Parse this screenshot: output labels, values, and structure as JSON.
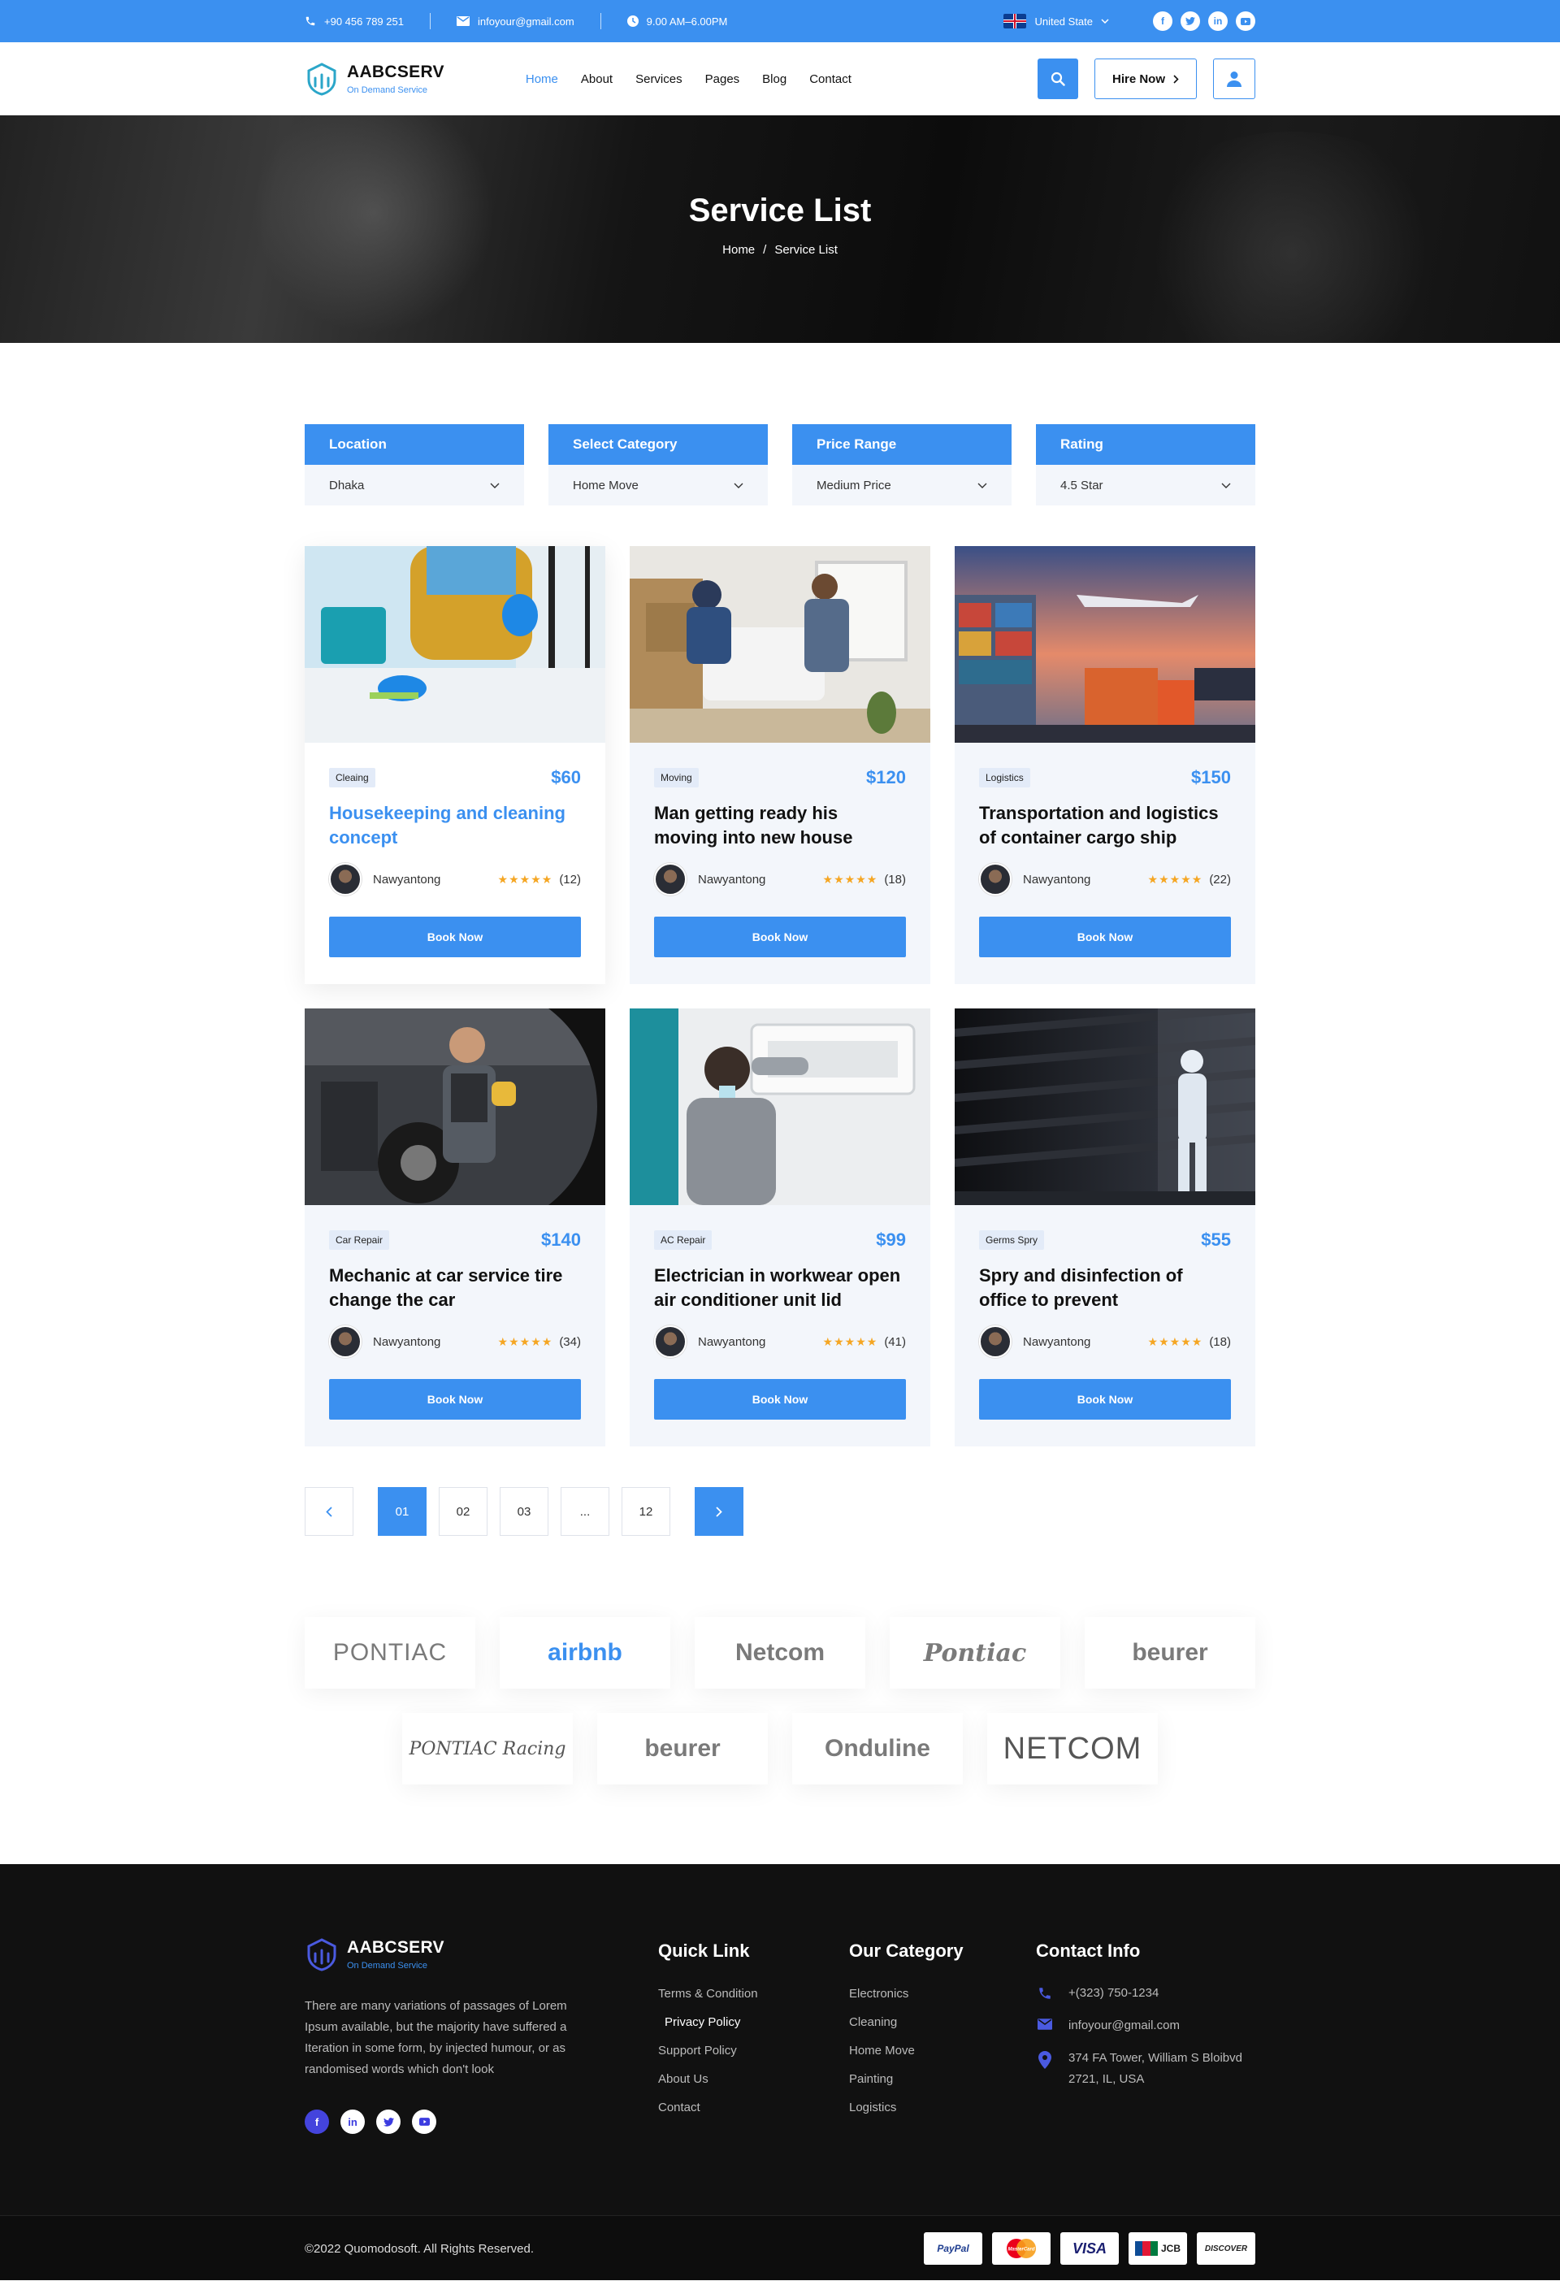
{
  "topbar": {
    "phone": "+90 456 789 251",
    "email": "infoyour@gmail.com",
    "hours": "9.00 AM–6.00PM",
    "country": "United State",
    "social": [
      "facebook-icon",
      "twitter-icon",
      "linkedin-icon",
      "youtube-icon"
    ]
  },
  "brand": {
    "name": "AABCSERV",
    "tagline": "On Demand Service"
  },
  "nav": {
    "items": [
      "Home",
      "About",
      "Services",
      "Pages",
      "Blog",
      "Contact"
    ],
    "active": "Home",
    "hire_label": "Hire Now"
  },
  "hero": {
    "title": "Service List",
    "crumb_home": "Home",
    "crumb_sep": "/",
    "crumb_current": "Service List"
  },
  "filters": [
    {
      "label": "Location",
      "value": "Dhaka"
    },
    {
      "label": "Select Category",
      "value": "Home Move"
    },
    {
      "label": "Price Range",
      "value": "Medium Price"
    },
    {
      "label": "Rating",
      "value": "4.5 Star"
    }
  ],
  "services": [
    {
      "tag": "Cleaing",
      "price": "$60",
      "title": "Housekeeping and cleaning concept",
      "author": "Nawyantong",
      "stars": "★★★★★",
      "reviews": "(12)",
      "book": "Book Now"
    },
    {
      "tag": "Moving",
      "price": "$120",
      "title": "Man getting ready his moving into new house",
      "author": "Nawyantong",
      "stars": "★★★★★",
      "reviews": "(18)",
      "book": "Book Now"
    },
    {
      "tag": "Logistics",
      "price": "$150",
      "title": "Transportation and logistics of container cargo ship",
      "author": "Nawyantong",
      "stars": "★★★★★",
      "reviews": "(22)",
      "book": "Book Now"
    },
    {
      "tag": "Car Repair",
      "price": "$140",
      "title": "Mechanic at car service tire change the car",
      "author": "Nawyantong",
      "stars": "★★★★★",
      "reviews": "(34)",
      "book": "Book Now"
    },
    {
      "tag": "AC Repair",
      "price": "$99",
      "title": "Electrician in workwear open air conditioner unit lid",
      "author": "Nawyantong",
      "stars": "★★★★★",
      "reviews": "(41)",
      "book": "Book Now"
    },
    {
      "tag": "Germs Spry",
      "price": "$55",
      "title": "Spry and disinfection of office to prevent",
      "author": "Nawyantong",
      "stars": "★★★★★",
      "reviews": "(18)",
      "book": "Book Now"
    }
  ],
  "pagination": {
    "pages": [
      "01",
      "02",
      "03",
      "...",
      "12"
    ],
    "active": "01"
  },
  "brands": {
    "row1": [
      "PONTIAC",
      "airbnb",
      "Netcom",
      "Pontiac",
      "beurer"
    ],
    "row2": [
      "PONTIAC Racing",
      "beurer",
      "Onduline",
      "NETCOM"
    ]
  },
  "footer": {
    "description": "There are many variations of passages of Lorem Ipsum available, but the majority have suffered a Iteration in some form, by injected humour, or as randomised words which don't look",
    "quick_title": "Quick Link",
    "quick_links": [
      "Terms & Condition",
      "Privacy Policy",
      "Support Policy",
      "About Us",
      "Contact"
    ],
    "category_title": "Our Category",
    "categories": [
      "Electronics",
      "Cleaning",
      "Home Move",
      "Painting",
      "Logistics"
    ],
    "contact_title": "Contact Info",
    "contact_phone": "+(323) 750-1234",
    "contact_email": "infoyour@gmail.com",
    "contact_address": "374 FA Tower, William S Bloibvd 2721, IL, USA",
    "copyright": "©2022 Quomodosoft. All Rights Reserved.",
    "payments": [
      "PayPal",
      "MasterCard",
      "VISA",
      "JCB",
      "DISCOVER"
    ]
  },
  "colors": {
    "accent": "#3b90f0",
    "star": "#f5a623",
    "footer_bg": "#111111"
  }
}
